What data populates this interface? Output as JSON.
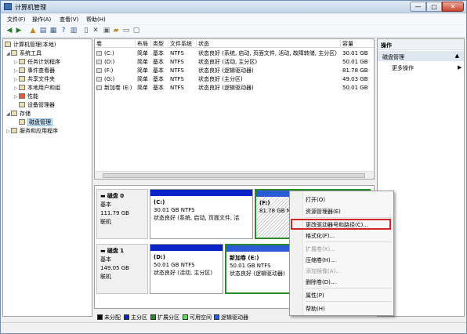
{
  "window": {
    "title": "计算机管理",
    "min": "—",
    "max": "□",
    "close": "✕"
  },
  "menu": [
    "文件(F)",
    "操作(A)",
    "查看(V)",
    "帮助(H)"
  ],
  "toolbar_icons": [
    "back-icon",
    "forward-icon",
    "up-icon",
    "show-hide-tree-icon",
    "help-icon",
    "properties-icon",
    "delete-icon",
    "paste-icon",
    "open-icon",
    "new-icon"
  ],
  "tree": {
    "root": "计算机管理(本地)",
    "system_tools": "系统工具",
    "items": [
      "任务计划程序",
      "事件查看器",
      "共享文件夹",
      "本地用户和组",
      "性能",
      "设备管理器"
    ],
    "storage": "存储",
    "disk_mgmt": "磁盘管理",
    "services": "服务和应用程序"
  },
  "volumes": {
    "headers": [
      "卷",
      "布局",
      "类型",
      "文件系统",
      "状态",
      "容量"
    ],
    "rows": [
      [
        "(C:)",
        "简单",
        "基本",
        "NTFS",
        "状态良好 (系统, 启动, 页面文件, 活动, 故障转储, 主分区)",
        "30.01 GB"
      ],
      [
        "(D:)",
        "简单",
        "基本",
        "NTFS",
        "状态良好 (活动, 主分区)",
        "50.01 GB"
      ],
      [
        "(F:)",
        "简单",
        "基本",
        "NTFS",
        "状态良好 (逻辑驱动器)",
        "81.78 GB"
      ],
      [
        "(G:)",
        "简单",
        "基本",
        "NTFS",
        "状态良好 (主分区)",
        "49.03 GB"
      ],
      [
        "新加卷 (E:)",
        "简单",
        "基本",
        "NTFS",
        "状态良好 (逻辑驱动器)",
        "50.01 GB"
      ]
    ]
  },
  "disks": [
    {
      "name": "磁盘 0",
      "type": "基本",
      "size": "111.79 GB",
      "status": "联机",
      "parts": [
        {
          "label": "(C:)",
          "size": "30.01 GB NTFS",
          "status": "状态良好 (系统, 启动, 页面文件, 活"
        },
        {
          "label": "(F:)",
          "size": "81.78 GB NTFS",
          "status": ""
        }
      ]
    },
    {
      "name": "磁盘 1",
      "type": "基本",
      "size": "149.05 GB",
      "status": "联机",
      "parts": [
        {
          "label": "(D:)",
          "size": "50.01 GB NTFS",
          "status": "状态良好 (活动, 主分区)"
        },
        {
          "label": "新加卷 (E:)",
          "size": "50.01 GB NTFS",
          "status": "状态良好 (逻辑驱动器)"
        }
      ]
    }
  ],
  "legend": [
    {
      "label": "未分配",
      "color": "#000000"
    },
    {
      "label": "主分区",
      "color": "#0a24c8"
    },
    {
      "label": "扩展分区",
      "color": "#2a8a2a"
    },
    {
      "label": "可用空间",
      "color": "#5ce05c"
    },
    {
      "label": "逻辑驱动器",
      "color": "#2b5bd7"
    }
  ],
  "actions": {
    "header": "操作",
    "section": "磁盘管理",
    "item": "更多操作"
  },
  "context_menu": [
    {
      "label": "打开(O)",
      "disabled": false
    },
    {
      "label": "资源管理器(E)",
      "disabled": false
    },
    {
      "label": "更改驱动器号和路径(C)...",
      "disabled": false
    },
    {
      "label": "格式化(F)...",
      "disabled": false
    },
    {
      "label": "扩展卷(X)...",
      "disabled": true
    },
    {
      "label": "压缩卷(H)...",
      "disabled": false
    },
    {
      "label": "添加镜像(A)...",
      "disabled": true
    },
    {
      "label": "删除卷(D)...",
      "disabled": false
    },
    {
      "label": "属性(P)",
      "disabled": false
    },
    {
      "label": "帮助(H)",
      "disabled": false
    }
  ]
}
